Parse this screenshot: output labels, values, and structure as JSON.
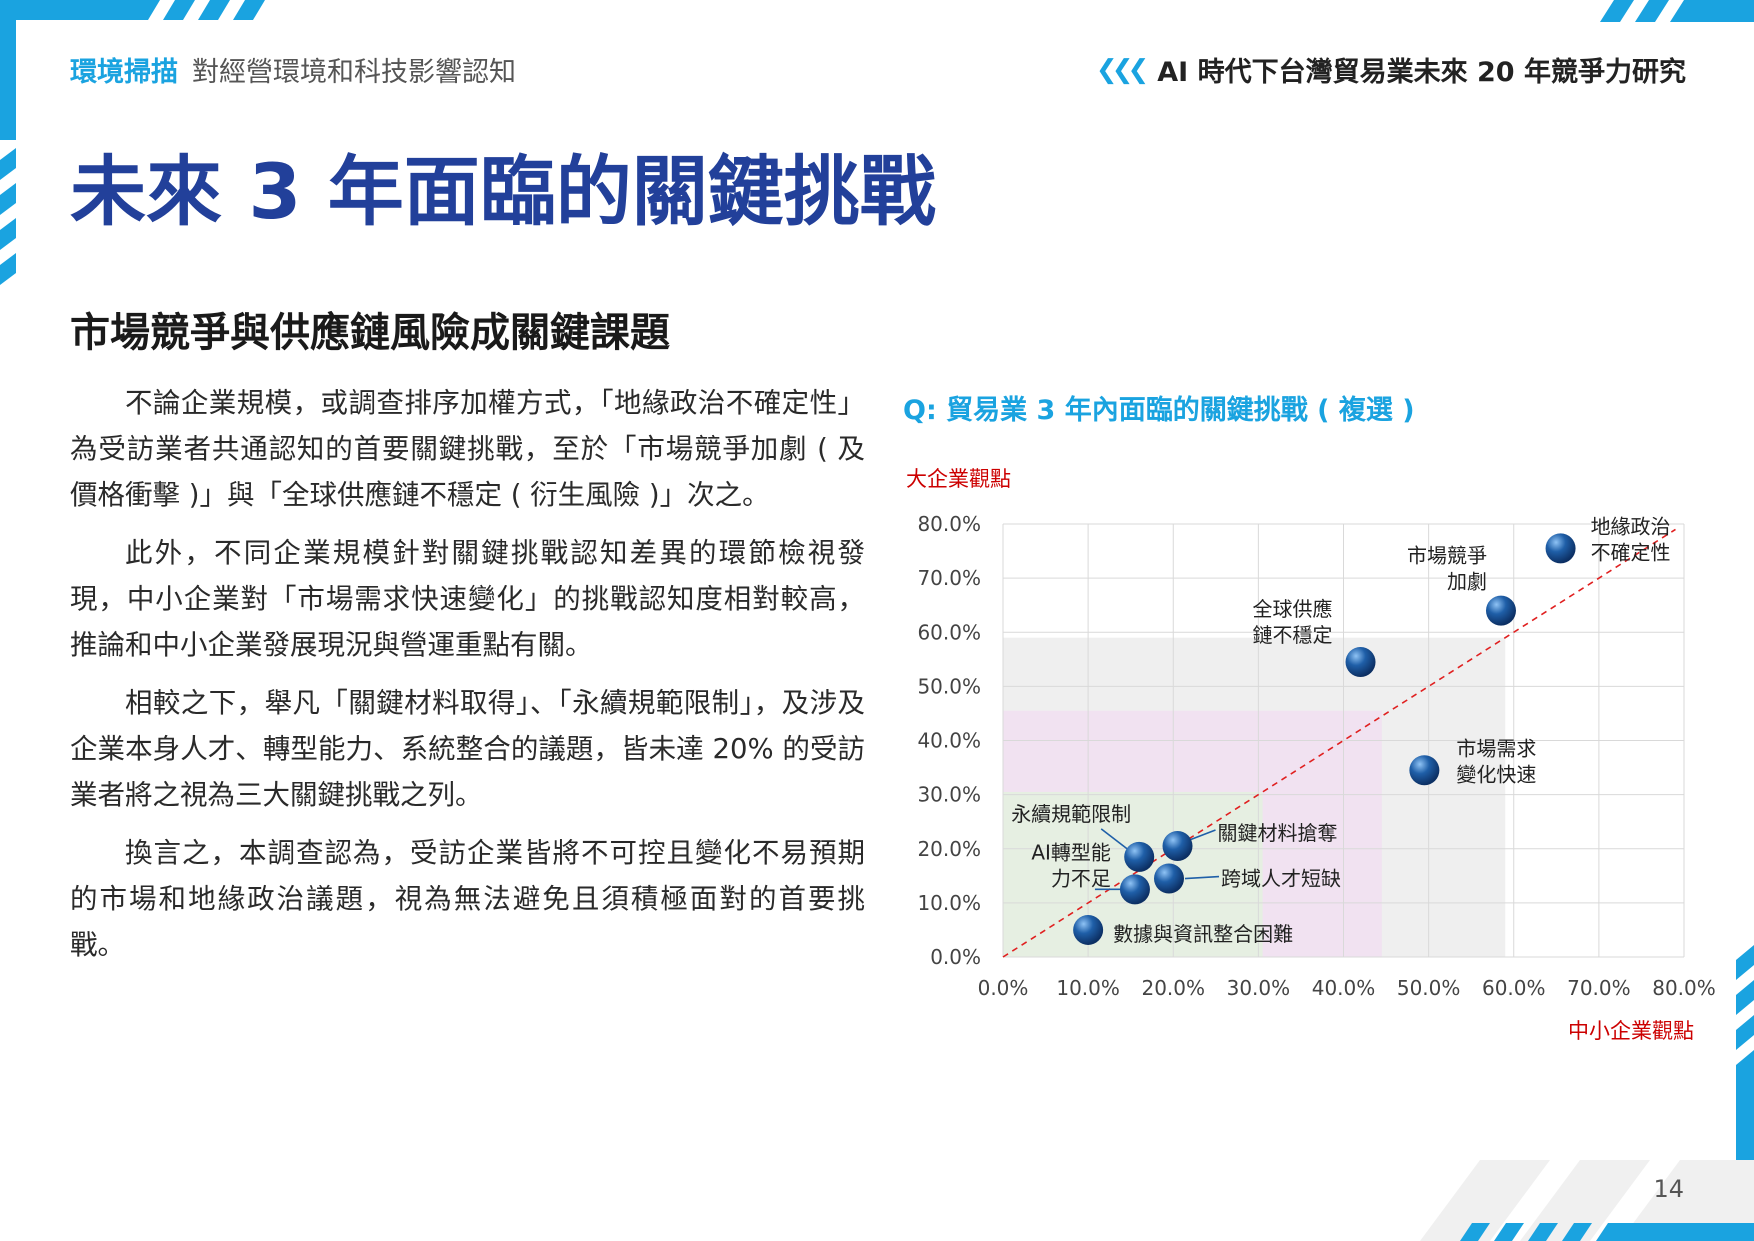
{
  "header": {
    "section": "環境掃描",
    "section_desc": "對經營環境和科技影響認知",
    "report_title": "AI 時代下台灣貿易業未來 20 年競爭力研究"
  },
  "page_title": "未來 3 年面臨的關鍵挑戰",
  "subtitle": "市場競爭與供應鏈風險成關鍵課題",
  "paragraphs": [
    "不論企業規模，或調查排序加權方式，「地緣政治不確定性」為受訪業者共通認知的首要關鍵挑戰，至於「市場競爭加劇 ( 及價格衝擊 )」與「全球供應鏈不穩定 ( 衍生風險 )」次之。",
    "此外，不同企業規模針對關鍵挑戰認知差異的環節檢視發現，中小企業對「市場需求快速變化」的挑戰認知度相對較高，推論和中小企業發展現況與營運重點有關。",
    "相較之下，舉凡「關鍵材料取得」、「永續規範限制」，及涉及企業本身人才、轉型能力、系統整合的議題，皆未達 20% 的受訪業者將之視為三大關鍵挑戰之列。",
    "換言之，本調查認為，受訪企業皆將不可控且變化不易預期的市場和地緣政治議題，視為無法避免且須積極面對的首要挑戰。"
  ],
  "page_number": "14",
  "colors": {
    "accent_blue": "#1aa3e0",
    "title_navy": "#22409a",
    "axis_label_red": "#cc0000",
    "point_blue": "#1f5fa8"
  },
  "chart_data": {
    "type": "scatter",
    "title": "Q: 貿易業 3 年內面臨的關鍵挑戰 ( 複選 )",
    "xlabel": "中小企業觀點",
    "ylabel": "大企業觀點",
    "xlim": [
      0,
      80
    ],
    "ylim": [
      0,
      80
    ],
    "xticks": [
      "0.0%",
      "10.0%",
      "20.0%",
      "30.0%",
      "40.0%",
      "50.0%",
      "60.0%",
      "70.0%",
      "80.0%"
    ],
    "yticks": [
      "0.0%",
      "10.0%",
      "20.0%",
      "30.0%",
      "40.0%",
      "50.0%",
      "60.0%",
      "70.0%",
      "80.0%"
    ],
    "grid": true,
    "diagonal_reference": true,
    "shaded_regions": [
      {
        "x_max": 59,
        "y_max": 59,
        "color": "#efefef"
      },
      {
        "x_max": 44.5,
        "y_max": 45.5,
        "color": "#f1e2f1"
      },
      {
        "x_max": 30.5,
        "y_max": 30.5,
        "color": "#e6efe2"
      }
    ],
    "points": [
      {
        "label": "地緣政治不確定性",
        "label_lines": [
          "地緣政治",
          "不確定性"
        ],
        "x": 65.5,
        "y": 75.5
      },
      {
        "label": "市場競爭加劇",
        "label_lines": [
          "市場競爭",
          "加劇"
        ],
        "x": 58.5,
        "y": 64.0
      },
      {
        "label": "全球供應鏈不穩定",
        "label_lines": [
          "全球供應",
          "鏈不穩定"
        ],
        "x": 42.0,
        "y": 54.5
      },
      {
        "label": "市場需求變化快速",
        "label_lines": [
          "市場需求",
          "變化快速"
        ],
        "x": 49.5,
        "y": 34.5
      },
      {
        "label": "關鍵材料搶奪",
        "label_lines": [
          "關鍵材料搶奪"
        ],
        "x": 20.5,
        "y": 20.5
      },
      {
        "label": "永續規範限制",
        "label_lines": [
          "永續規範限制"
        ],
        "x": 16.0,
        "y": 18.5
      },
      {
        "label": "跨域人才短缺",
        "label_lines": [
          "跨域人才短缺"
        ],
        "x": 19.5,
        "y": 14.5
      },
      {
        "label": "AI轉型能力不足",
        "label_lines": [
          "AI轉型能",
          "力不足"
        ],
        "x": 15.5,
        "y": 12.5
      },
      {
        "label": "數據與資訊整合困難",
        "label_lines": [
          "數據與資訊整合困難"
        ],
        "x": 10.0,
        "y": 5.0
      }
    ]
  }
}
